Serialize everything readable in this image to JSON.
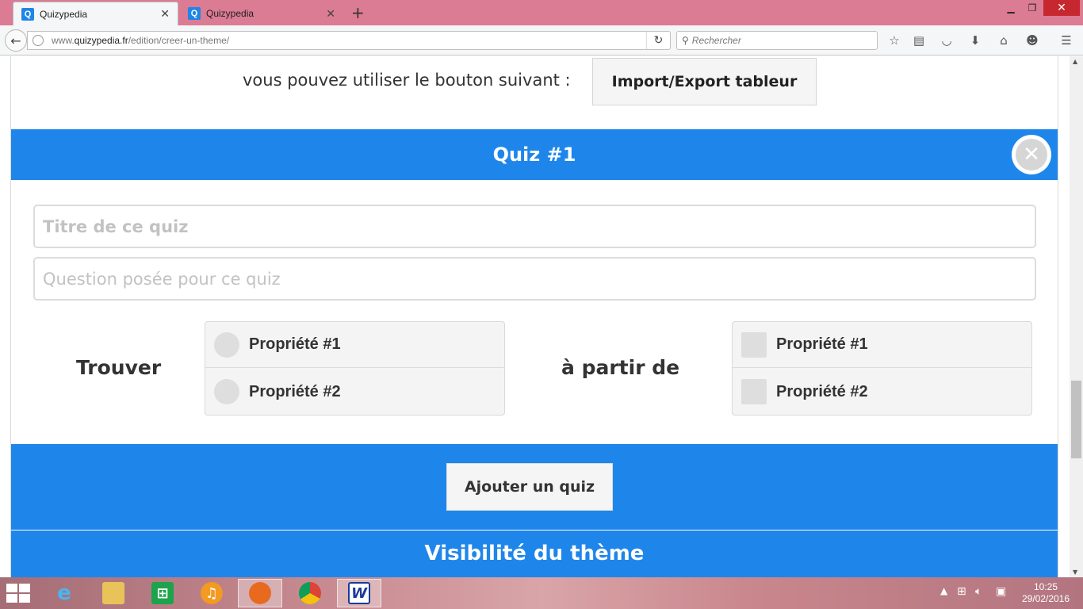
{
  "browser": {
    "tabs": [
      {
        "title": "Quizypedia",
        "active": true
      },
      {
        "title": "Quizypedia",
        "active": false
      }
    ],
    "url_prefix": "www.",
    "url_domain": "quizypedia.fr",
    "url_path": "/edition/creer-un-theme/",
    "search_placeholder": "Rechercher",
    "favicon_letter": "Q"
  },
  "page": {
    "import_text": "vous pouvez utiliser le bouton suivant :",
    "import_button": "Import/Export tableur",
    "quiz_title": "Quiz #1",
    "title_placeholder": "Titre de ce quiz",
    "question_placeholder": "Question posée pour ce quiz",
    "find_label": "Trouver",
    "from_label": "à partir de",
    "find_options": [
      "Propriété #1",
      "Propriété #2"
    ],
    "from_options": [
      "Propriété #1",
      "Propriété #2"
    ],
    "add_quiz_button": "Ajouter un quiz",
    "visibility_title": "Visibilité du thème"
  },
  "taskbar": {
    "time": "10:25",
    "date": "29/02/2016",
    "word_letter": "W"
  },
  "colors": {
    "accent": "#1e86eb",
    "tabstrip": "#db7b94",
    "close_button": "#c7272f"
  }
}
